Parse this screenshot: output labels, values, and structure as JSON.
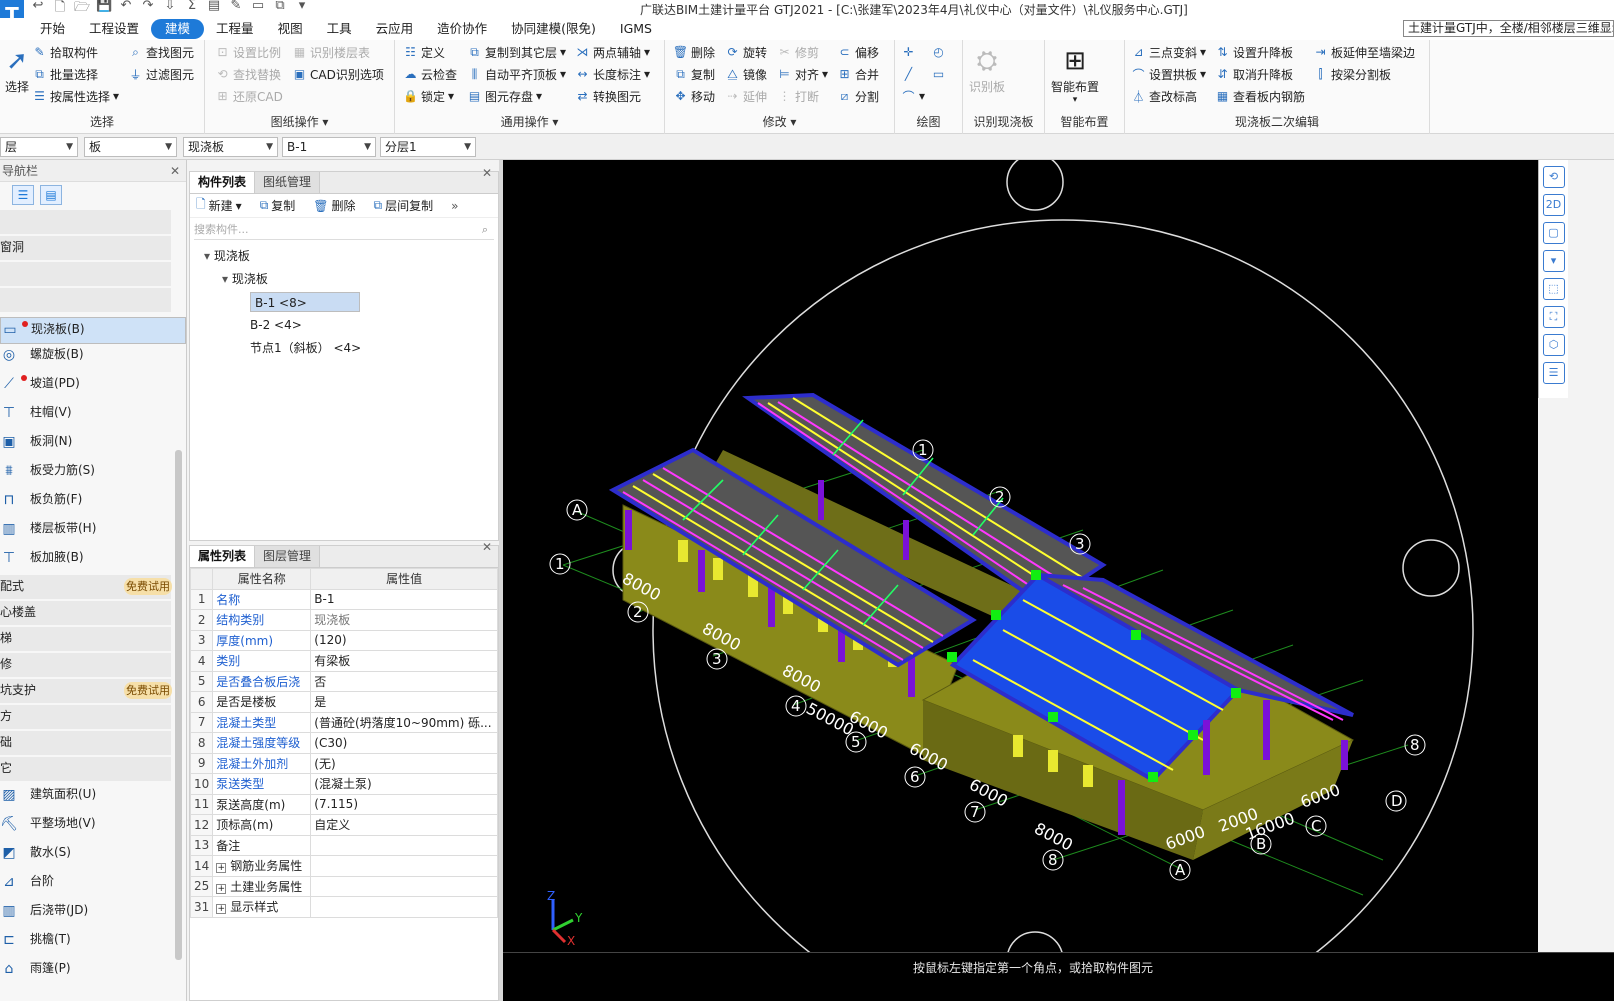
{
  "app": {
    "title": "广联达BIM土建计量平台 GTJ2021 - [C:\\张建军\\2023年4月\\礼仪中心（对量文件）\\礼仪服务中心.GTJ]",
    "logo": "T",
    "notice": "土建计量GTJ中，全楼/相邻楼层三维显示"
  },
  "quick_access": [
    "↩",
    "🗋",
    "🗁",
    "💾",
    "↶",
    "↷",
    "⇩",
    "Σ",
    "▤",
    "✎",
    "▭",
    "⧉",
    "▾"
  ],
  "menus": [
    {
      "label": "开始",
      "active": false
    },
    {
      "label": "工程设置",
      "active": false
    },
    {
      "label": "建模",
      "active": true
    },
    {
      "label": "工程量",
      "active": false
    },
    {
      "label": "视图",
      "active": false
    },
    {
      "label": "工具",
      "active": false
    },
    {
      "label": "云应用",
      "active": false
    },
    {
      "label": "造价协作",
      "active": false
    },
    {
      "label": "协同建模(限免)",
      "active": false
    },
    {
      "label": "IGMS",
      "active": false
    }
  ],
  "ribbon": {
    "select_group": {
      "label": "选择",
      "big": "选择",
      "buttons": [
        "拾取构件",
        "批量选择",
        "按属性选择",
        "查找图元",
        "过滤图元"
      ]
    },
    "drawing_group": {
      "label": "图纸操作",
      "buttons": [
        "设置比例",
        "查找替换",
        "还原CAD",
        "识别楼层表",
        "CAD识别选项"
      ]
    },
    "common_group": {
      "label": "通用操作",
      "buttons": [
        "定义",
        "云检查",
        "锁定",
        "复制到其它层",
        "自动平齐顶板",
        "图元存盘",
        "两点辅轴",
        "长度标注",
        "转换图元"
      ]
    },
    "modify_group": {
      "label": "修改",
      "buttons": [
        "删除",
        "复制",
        "移动",
        "旋转",
        "镜像",
        "延伸",
        "修剪",
        "对齐",
        "打断",
        "偏移",
        "合并",
        "分割"
      ]
    },
    "draw_group": {
      "label": "绘图"
    },
    "recog_group": {
      "label": "识别现浇板",
      "big": "识别板"
    },
    "smart_group": {
      "label": "智能布置",
      "big": "智能布置"
    },
    "edit_group": {
      "label": "现浇板二次编辑",
      "buttons": [
        "三点变斜",
        "设置拱板",
        "查改标高",
        "设置升降板",
        "取消升降板",
        "查看板内钢筋",
        "板延伸至墙梁边",
        "按梁分割板"
      ]
    }
  },
  "filters": [
    "层",
    "板",
    "现浇板",
    "B-1",
    "分层1"
  ],
  "nav": {
    "header": "导航栏",
    "items": [
      {
        "label": "",
        "kind": "cat"
      },
      {
        "label": "窗洞",
        "kind": "cat"
      },
      {
        "label": "",
        "kind": "cat"
      },
      {
        "label": "",
        "kind": "cat"
      },
      {
        "label": "现浇板(B)",
        "kind": "sub",
        "icon": "▭",
        "dot": true,
        "selected": true
      },
      {
        "label": "螺旋板(B)",
        "kind": "sub",
        "icon": "◎"
      },
      {
        "label": "坡道(PD)",
        "kind": "sub",
        "icon": "⟋",
        "dot": true
      },
      {
        "label": "柱帽(V)",
        "kind": "sub",
        "icon": "⊤"
      },
      {
        "label": "板洞(N)",
        "kind": "sub",
        "icon": "▣"
      },
      {
        "label": "板受力筋(S)",
        "kind": "sub",
        "icon": "⩩"
      },
      {
        "label": "板负筋(F)",
        "kind": "sub",
        "icon": "⊓"
      },
      {
        "label": "楼层板带(H)",
        "kind": "sub",
        "icon": "▥"
      },
      {
        "label": "板加腋(B)",
        "kind": "sub",
        "icon": "⊤"
      },
      {
        "label": "配式",
        "kind": "cat",
        "badge": "免费试用"
      },
      {
        "label": "心楼盖",
        "kind": "cat"
      },
      {
        "label": "梯",
        "kind": "cat"
      },
      {
        "label": "修",
        "kind": "cat"
      },
      {
        "label": "坑支护",
        "kind": "cat",
        "badge": "免费试用"
      },
      {
        "label": "方",
        "kind": "cat"
      },
      {
        "label": "础",
        "kind": "cat"
      },
      {
        "label": "它",
        "kind": "cat"
      },
      {
        "label": "建筑面积(U)",
        "kind": "sub",
        "icon": "▨"
      },
      {
        "label": "平整场地(V)",
        "kind": "sub",
        "icon": "⛏"
      },
      {
        "label": "散水(S)",
        "kind": "sub",
        "icon": "◩"
      },
      {
        "label": "台阶",
        "kind": "sub",
        "icon": "⊿"
      },
      {
        "label": "后浇带(JD)",
        "kind": "sub",
        "icon": "▥"
      },
      {
        "label": "挑檐(T)",
        "kind": "sub",
        "icon": "⊏"
      },
      {
        "label": "雨篷(P)",
        "kind": "sub",
        "icon": "⌂"
      }
    ]
  },
  "component_panel": {
    "tabs": [
      "构件列表",
      "图纸管理"
    ],
    "tools": [
      "新建",
      "复制",
      "删除",
      "层间复制"
    ],
    "search_placeholder": "搜索构件...",
    "tree": [
      {
        "label": "现浇板",
        "level": 0,
        "expanded": true
      },
      {
        "label": "现浇板",
        "level": 1,
        "expanded": true
      },
      {
        "label": "B-1 <8>",
        "level": 2,
        "selected": true
      },
      {
        "label": "B-2 <4>",
        "level": 2
      },
      {
        "label": "节点1（斜板） <4>",
        "level": 2
      }
    ]
  },
  "property_panel": {
    "tabs": [
      "属性列表",
      "图层管理"
    ],
    "header_name": "属性名称",
    "header_value": "属性值",
    "rows": [
      {
        "n": "1",
        "name": "名称",
        "value": "B-1",
        "blue": true
      },
      {
        "n": "2",
        "name": "结构类别",
        "value": "现浇板",
        "blue": true,
        "gray": true
      },
      {
        "n": "3",
        "name": "厚度(mm)",
        "value": "(120)",
        "blue": true
      },
      {
        "n": "4",
        "name": "类别",
        "value": "有梁板",
        "blue": true
      },
      {
        "n": "5",
        "name": "是否叠合板后浇",
        "value": "否",
        "blue": true
      },
      {
        "n": "6",
        "name": "是否是楼板",
        "value": "是"
      },
      {
        "n": "7",
        "name": "混凝土类型",
        "value": "(普通砼(坍落度10~90mm)  砾...",
        "blue": true
      },
      {
        "n": "8",
        "name": "混凝土强度等级",
        "value": "(C30)",
        "blue": true
      },
      {
        "n": "9",
        "name": "混凝土外加剂",
        "value": "(无)",
        "blue": true
      },
      {
        "n": "10",
        "name": "泵送类型",
        "value": "(混凝土泵)",
        "blue": true
      },
      {
        "n": "11",
        "name": "泵送高度(m)",
        "value": "(7.115)"
      },
      {
        "n": "12",
        "name": "顶标高(m)",
        "value": "自定义"
      },
      {
        "n": "13",
        "name": "备注",
        "value": ""
      },
      {
        "n": "14",
        "name": "钢筋业务属性",
        "value": "",
        "exp": true
      },
      {
        "n": "25",
        "name": "土建业务属性",
        "value": "",
        "exp": true
      },
      {
        "n": "31",
        "name": "显示样式",
        "value": "",
        "exp": true
      }
    ]
  },
  "viewport": {
    "axis_numbers": [
      "1",
      "2",
      "3",
      "4",
      "5",
      "6",
      "7",
      "8"
    ],
    "axis_letters": [
      "A",
      "B",
      "C",
      "D"
    ],
    "dims_left": [
      "8000",
      "8000",
      "8000",
      "50000",
      "6000",
      "6000",
      "6000",
      "8000"
    ],
    "dims_right": [
      "6000",
      "2000",
      "16000",
      "6000"
    ],
    "triad": {
      "z": "Z",
      "y": "Y",
      "x": "X"
    }
  },
  "status": {
    "text": "按鼠标左键指定第一个角点，或拾取构件图元"
  },
  "side_tools": [
    "⟲",
    "2D",
    "▢",
    "▾",
    "⬚",
    "⛶",
    "⬡",
    "☰"
  ]
}
